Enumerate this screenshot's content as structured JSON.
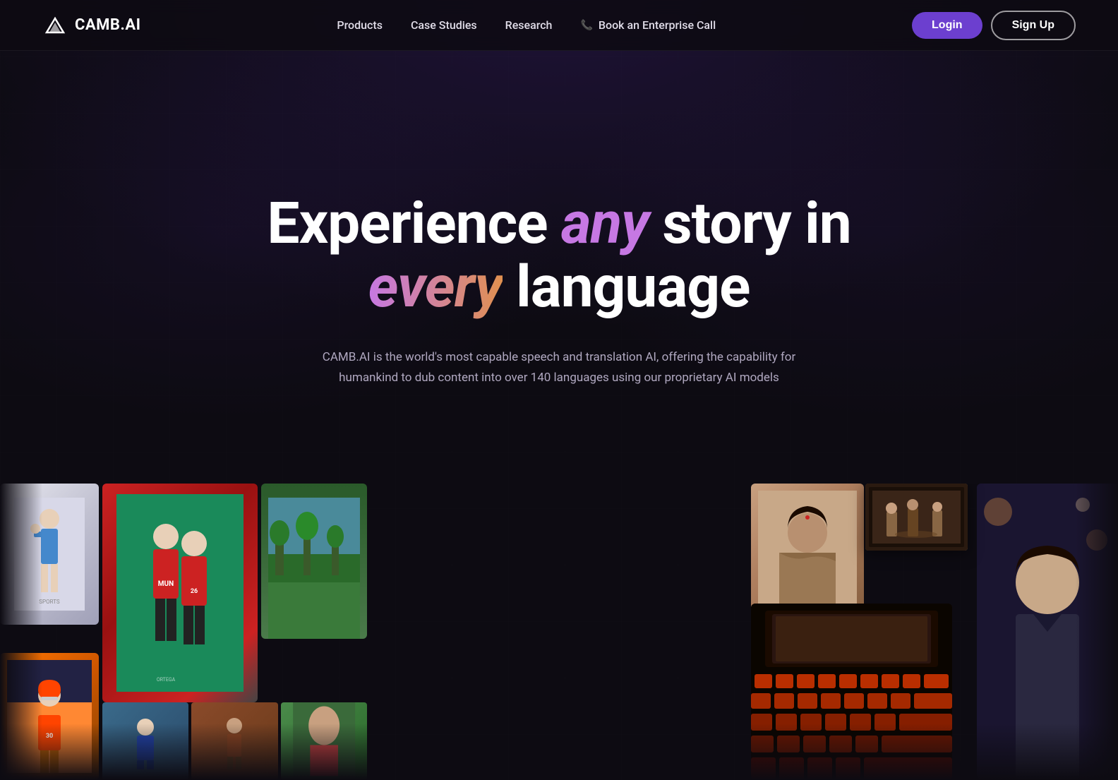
{
  "nav": {
    "logo_text": "CAMB.AI",
    "items": [
      {
        "label": "Products",
        "href": "#"
      },
      {
        "label": "Case Studies",
        "href": "#"
      },
      {
        "label": "Research",
        "href": "#"
      },
      {
        "label": "Book an Enterprise Call",
        "href": "#"
      }
    ],
    "login_label": "Login",
    "signup_label": "Sign Up"
  },
  "hero": {
    "title_part1": "Experience ",
    "title_any": "any",
    "title_part2": " story in",
    "title_every": "every",
    "title_language": " language",
    "subtitle": "CAMB.AI is the world's most capable speech and translation AI, offering the capability for humankind to dub content into over 140 languages using our proprietary AI models"
  },
  "colors": {
    "accent_purple": "#6c3fcf",
    "highlight_any": "#c678e3",
    "bg_dark": "#0d0b12"
  }
}
